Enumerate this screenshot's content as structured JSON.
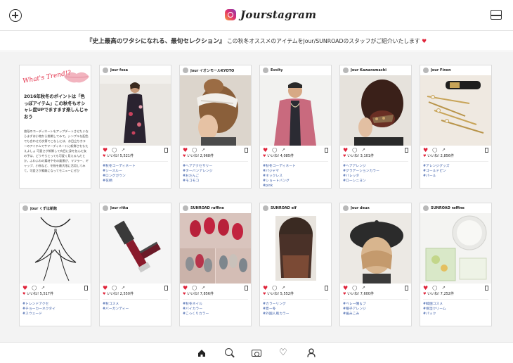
{
  "header": {
    "app_name": "Jourstagram"
  },
  "banner": {
    "headline": "『史上最高のワタシになれる、最旬セレクション』",
    "text": "この秋冬オススメのアイテムをJour/SUNROADのスタッフがご紹介いたします"
  },
  "trend_card": {
    "title": "What's Trend!?",
    "headline": "2016年秋冬のポイントは「色っぽアイテム」この秋冬もオシャレ度UPでますます楽しんじゃおう",
    "body": "普段のコーディネートをアップデートさせたいならまずは小物から挑戦してみて。シンプルな配色でも合わせ方次第でこなしには、お目立ちカラーのアイテムでサマーディネートに新鮮さをもたえよしょ 可愛さが新鮮して有目に身を包んだ女の子は、どうやらとっても可愛く見えるんだとか。ふわふわの素材や冬の風景が、マフラー、ギャップ、小物など、冬物を最大限に活用してみて。可愛さが素敵になってモニューにぜひ"
  },
  "posts": [
    {
      "user": "Jour fosa",
      "likes": "いいね! 5,521件",
      "tags": [
        "#秋冬コーディネート",
        "#シースルー",
        "#ロングガウン",
        "#花柄"
      ],
      "photo": "woman-sheer-floral-dress"
    },
    {
      "user": "Jour イオンモールKYOTO",
      "likes": "いいね! 2,968件",
      "tags": [
        "#ヘアアクセサリー",
        "#ターバンアレンジ",
        "#おだんご",
        "#モコモコ"
      ],
      "photo": "hair-turban"
    },
    {
      "user": "Evolty",
      "likes": "いいね! 4,085件",
      "tags": [
        "#秋冬コーディネート",
        "#パジャマ",
        "#ネックレス",
        "#ショートバング",
        "#pink"
      ],
      "photo": "woman-pink-cardigan"
    },
    {
      "user": "Jour Kawaramachi",
      "likes": "いいね! 3,101件",
      "tags": [
        "#ヘアアレンジ",
        "#グラデーションカラー",
        "#バレッタ",
        "#ローシニヨン"
      ],
      "photo": "hair-bun-clip"
    },
    {
      "user": "Jour Finon",
      "likes": "いいね! 2,856件",
      "tags": [
        "#アレンジグッズ",
        "#ゴールドピン",
        "#パール"
      ],
      "photo": "hair-pins"
    },
    {
      "user": "Jour くずは新館",
      "likes": "いいね! 5,517件",
      "tags": [
        "#トレンドアクセ",
        "#チョーカーネクタイ",
        "#スウェード"
      ],
      "photo": "choker"
    },
    {
      "user": "Jour ritta",
      "likes": "いいね! 2,550件",
      "tags": [
        "#秋コスメ",
        "#バーガンディー"
      ],
      "photo": "lipstick"
    },
    {
      "user": "SUNROAD raffine",
      "likes": "いいね! 7,856件",
      "tags": [
        "#秋冬ネイル",
        "#バイカラー",
        "#こっくりカラー"
      ],
      "photo": "nails"
    },
    {
      "user": "SUNROAD elf",
      "likes": "いいね! 5,552件",
      "tags": [
        "#カラーリング",
        "#夏ー冬",
        "#外国人風カラー"
      ],
      "photo": "hair-color"
    },
    {
      "user": "Jour deux",
      "likes": "いいね! 7,600件",
      "tags": [
        "#ベレー帽＆ブ",
        "#帽子アレンジ",
        "#編みこみ"
      ],
      "photo": "beret"
    },
    {
      "user": "SUNROAD raffine",
      "likes": "いいね! 7,252件",
      "tags": [
        "#韓国コスメ",
        "#保湿クリーム",
        "#パック"
      ],
      "photo": "skincare"
    }
  ],
  "colors": {
    "heart": "#e0243a",
    "tag": "#3a5ca8",
    "feed_bg": "#f3f3f3"
  }
}
